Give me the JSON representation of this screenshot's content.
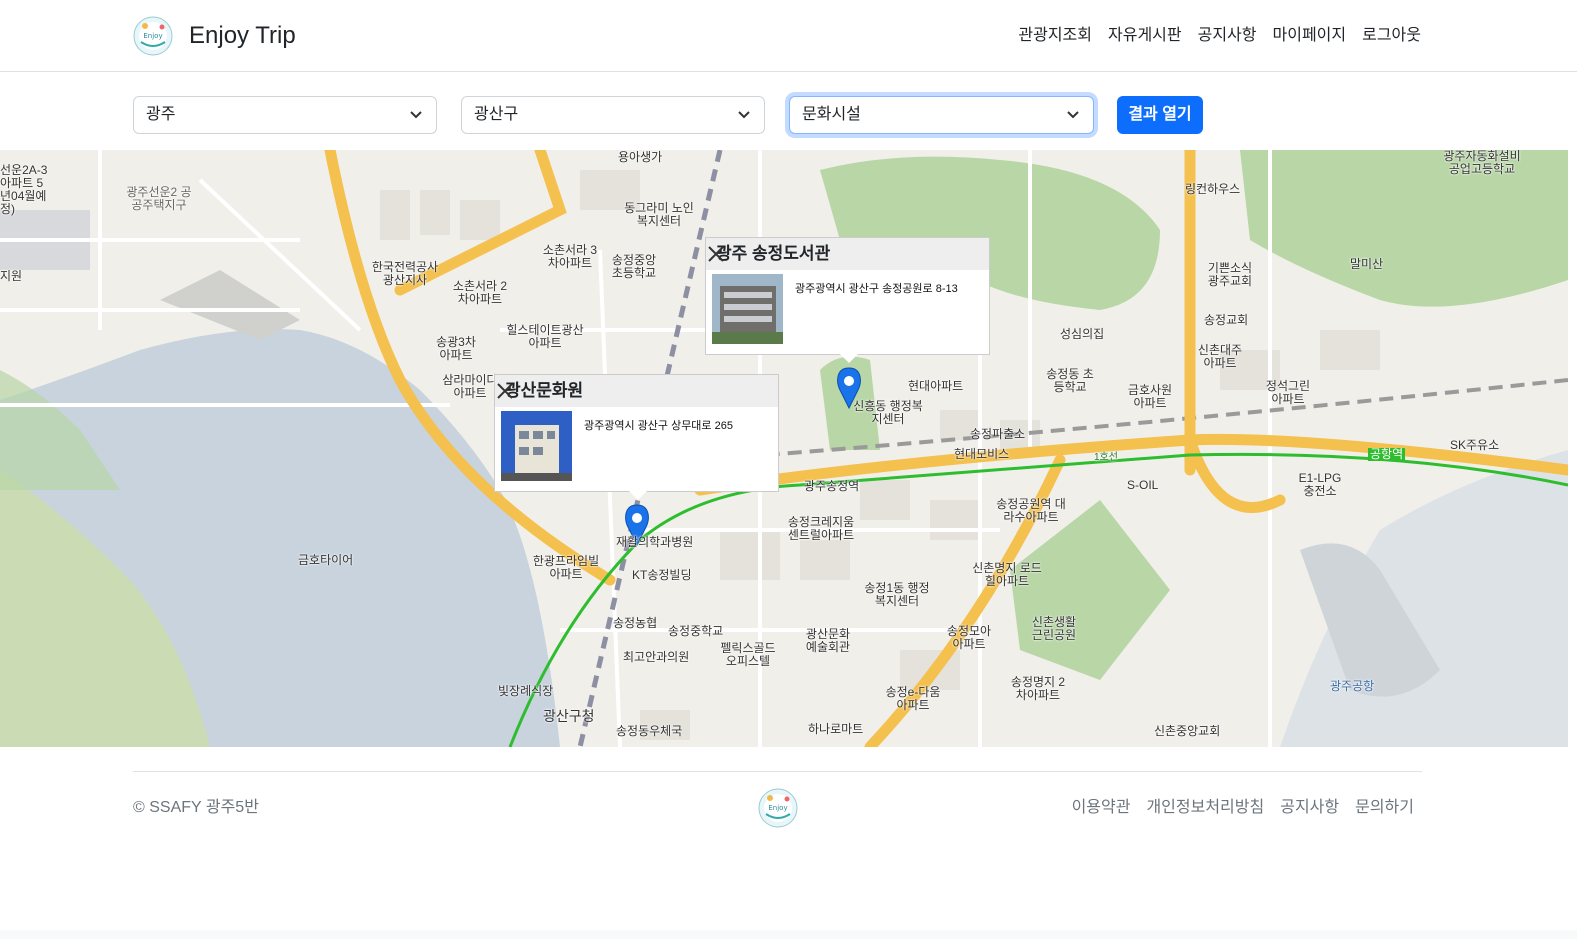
{
  "header": {
    "brand": "Enjoy Trip",
    "nav": [
      "관광지조회",
      "자유게시판",
      "공지사항",
      "마이페이지",
      "로그아웃"
    ]
  },
  "filters": {
    "region": "광주",
    "district": "광산구",
    "category": "문화시설",
    "button": "결과 열기"
  },
  "map": {
    "popups": [
      {
        "title": "광주 송정도서관",
        "address": "광주광역시 광산구 송정공원로 8-13"
      },
      {
        "title": "광산문화원",
        "address": "광주광역시 광산구 상무대로 265"
      }
    ],
    "labels": [
      "용아생가",
      "동그라미 노인복지센터",
      "소촌서라 3차아파트",
      "송정중앙 초등학교",
      "한국전력공사 광산지사",
      "소촌서라 2차아파트",
      "힐스테이트광산 아파트",
      "송광3차 아파트",
      "삼라마이다 아파트",
      "현대아파트",
      "신흥동 행정복지센터",
      "송정파출소",
      "현대모비스",
      "광주송정역",
      "재활의학과병원",
      "한광프라임빌 아파트",
      "KT송정빌딩",
      "금호타이어",
      "송정크레지움 센트럴아파트",
      "송정1동 행정복지센터",
      "송정공원역 대라수아파트",
      "신촌명지 로드힐아파트",
      "송정농협",
      "송정중학교",
      "최고안과의원",
      "펠릭스골드 오피스텔",
      "광산문화 예술회관",
      "송정모아 아파트",
      "신촌생활 근린공원",
      "송정명지 2차아파트",
      "빛장례식장",
      "광산구청",
      "송정동우체국",
      "하나로마트",
      "송정e-다움 아파트",
      "신촌중앙교회",
      "광주공항",
      "링컨하우스",
      "말미산",
      "기쁜소식 광주교회",
      "송정교회",
      "성심의집",
      "송정동 초등학교",
      "신촌대주 아파트",
      "금호사원 아파트",
      "정석그린 아파트",
      "SK주유소",
      "S-OIL",
      "E1-LPG 충전소",
      "공항역",
      "광주자동화설비 공업고등학교",
      "광주선운2 공공주택지구",
      "선운2A-3아파트 5년04월예정)",
      "지원",
      "1호선"
    ]
  },
  "footer": {
    "copyright": "© SSAFY 광주5반",
    "links": [
      "이용약관",
      "개인정보처리방침",
      "공지사항",
      "문의하기"
    ]
  }
}
